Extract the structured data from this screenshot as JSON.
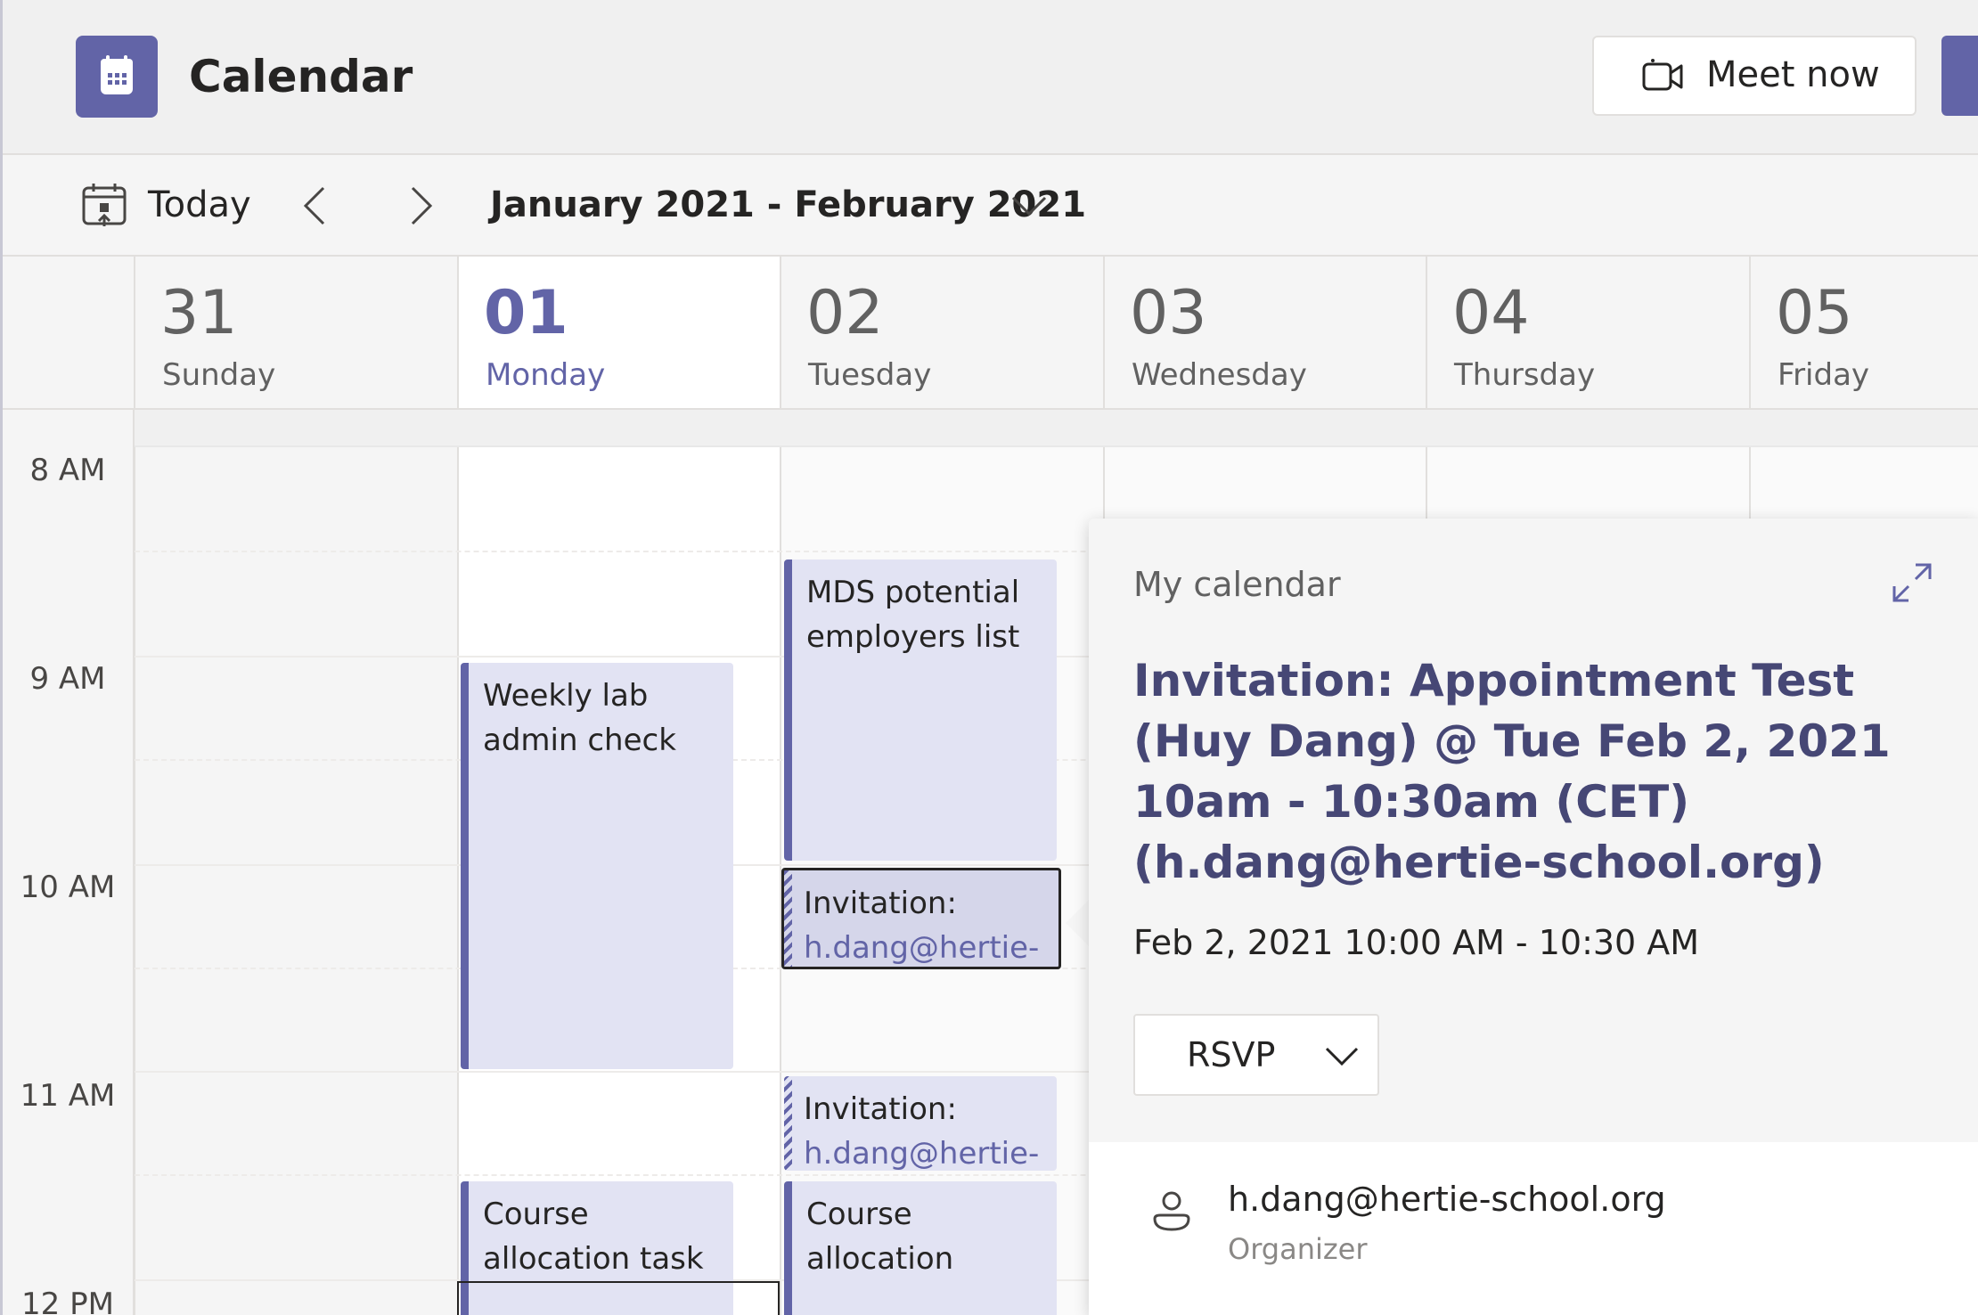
{
  "header": {
    "title": "Calendar",
    "meet_now_label": "Meet now"
  },
  "toolbar": {
    "today_label": "Today",
    "date_range": "January 2021 - February 2021"
  },
  "days": [
    {
      "number": "31",
      "name": "Sunday"
    },
    {
      "number": "01",
      "name": "Monday"
    },
    {
      "number": "02",
      "name": "Tuesday"
    },
    {
      "number": "03",
      "name": "Wednesday"
    },
    {
      "number": "04",
      "name": "Thursday"
    },
    {
      "number": "05",
      "name": "Friday"
    }
  ],
  "today_day_number": "01",
  "time_labels": [
    "8 AM",
    "9 AM",
    "10 AM",
    "11 AM",
    "12 PM"
  ],
  "events": {
    "mds": {
      "title": "MDS potential employers list"
    },
    "weekly_lab": {
      "title": "Weekly lab admin check"
    },
    "invitation_1": {
      "title": "Invitation:",
      "subtitle": "h.dang@hertie-"
    },
    "invitation_2": {
      "title": "Invitation:",
      "subtitle": "h.dang@hertie-"
    },
    "course_mon": {
      "title": "Course allocation task"
    },
    "course_tue": {
      "title": "Course allocation"
    }
  },
  "popup": {
    "calendar_name": "My calendar",
    "title": "Invitation: Appointment Test (Huy Dang) @ Tue Feb 2, 2021 10am - 10:30am (CET) (h.dang@hertie-school.org)",
    "time": "Feb 2, 2021 10:00 AM - 10:30 AM",
    "rsvp_label": "RSVP",
    "organizer_email": "h.dang@hertie-school.org",
    "organizer_role": "Organizer"
  },
  "colors": {
    "brand": "#6264a7",
    "event_fill": "#e2e3f3",
    "popup_title": "#464775"
  },
  "icons": [
    "calendar-app-icon",
    "video-camera-icon",
    "calendar-today-icon",
    "chevron-left-icon",
    "chevron-right-icon",
    "chevron-down-icon",
    "expand-icon",
    "person-icon"
  ]
}
